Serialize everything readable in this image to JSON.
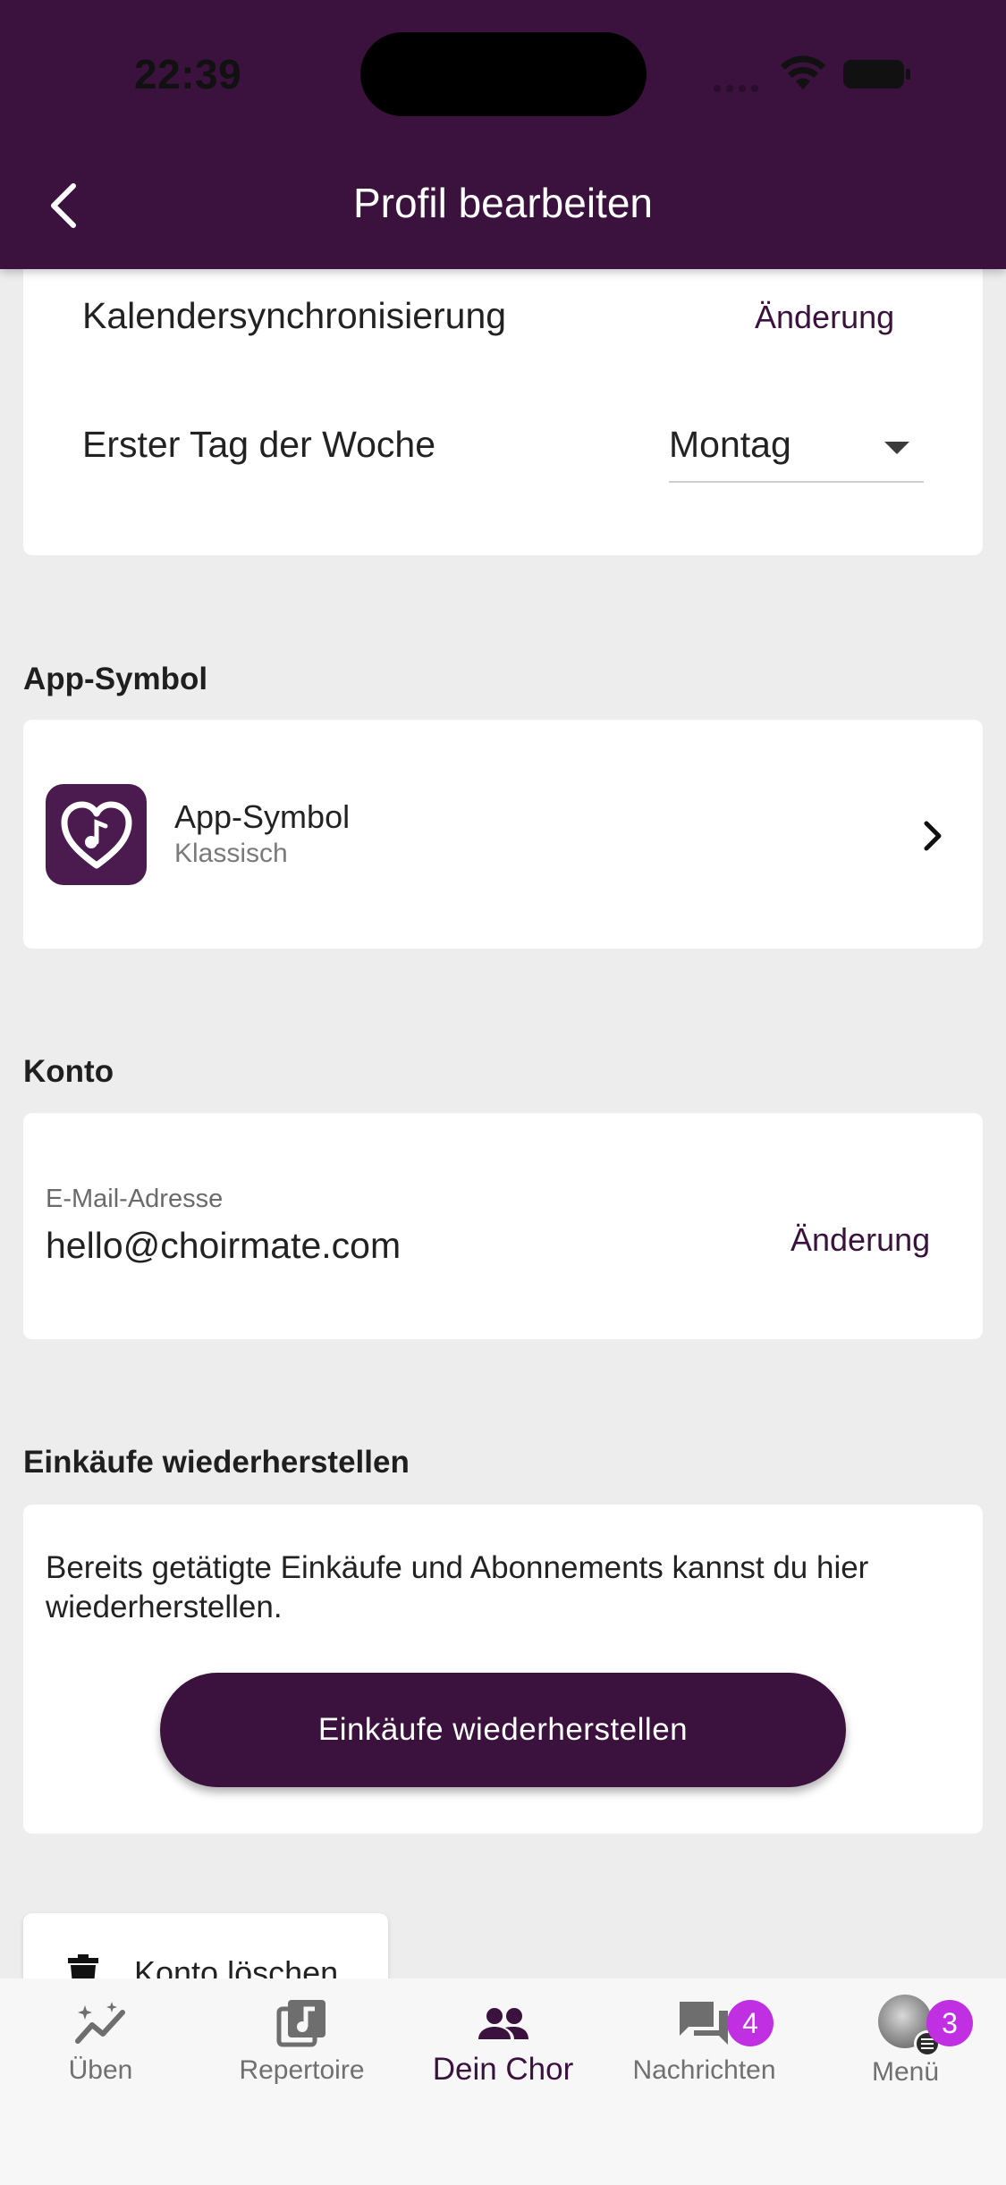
{
  "status_bar": {
    "time": "22:39"
  },
  "header": {
    "title": "Profil bearbeiten"
  },
  "calendar": {
    "sync_label": "Kalendersynchronisierung",
    "sync_action": "Änderung",
    "first_day_label": "Erster Tag der Woche",
    "first_day_value": "Montag"
  },
  "app_symbol": {
    "section_title": "App-Symbol",
    "title": "App-Symbol",
    "subtitle": "Klassisch"
  },
  "account": {
    "section_title": "Konto",
    "email_label": "E-Mail-Adresse",
    "email_value": "hello@choirmate.com",
    "email_action": "Änderung"
  },
  "restore": {
    "section_title": "Einkäufe wiederherstellen",
    "description": "Bereits getätigte Einkäufe und Abonnements kannst du hier wiederherstellen.",
    "button_label": "Einkäufe wiederherstellen"
  },
  "delete_account": {
    "label": "Konto löschen"
  },
  "bottom_nav": {
    "items": [
      {
        "label": "Üben"
      },
      {
        "label": "Repertoire"
      },
      {
        "label": "Dein Chor"
      },
      {
        "label": "Nachrichten",
        "badge": "4"
      },
      {
        "label": "Menü",
        "badge": "3"
      }
    ],
    "active_index": 2
  },
  "colors": {
    "primary": "#3a123d",
    "badge": "#c12fe3",
    "background": "#ededed"
  }
}
